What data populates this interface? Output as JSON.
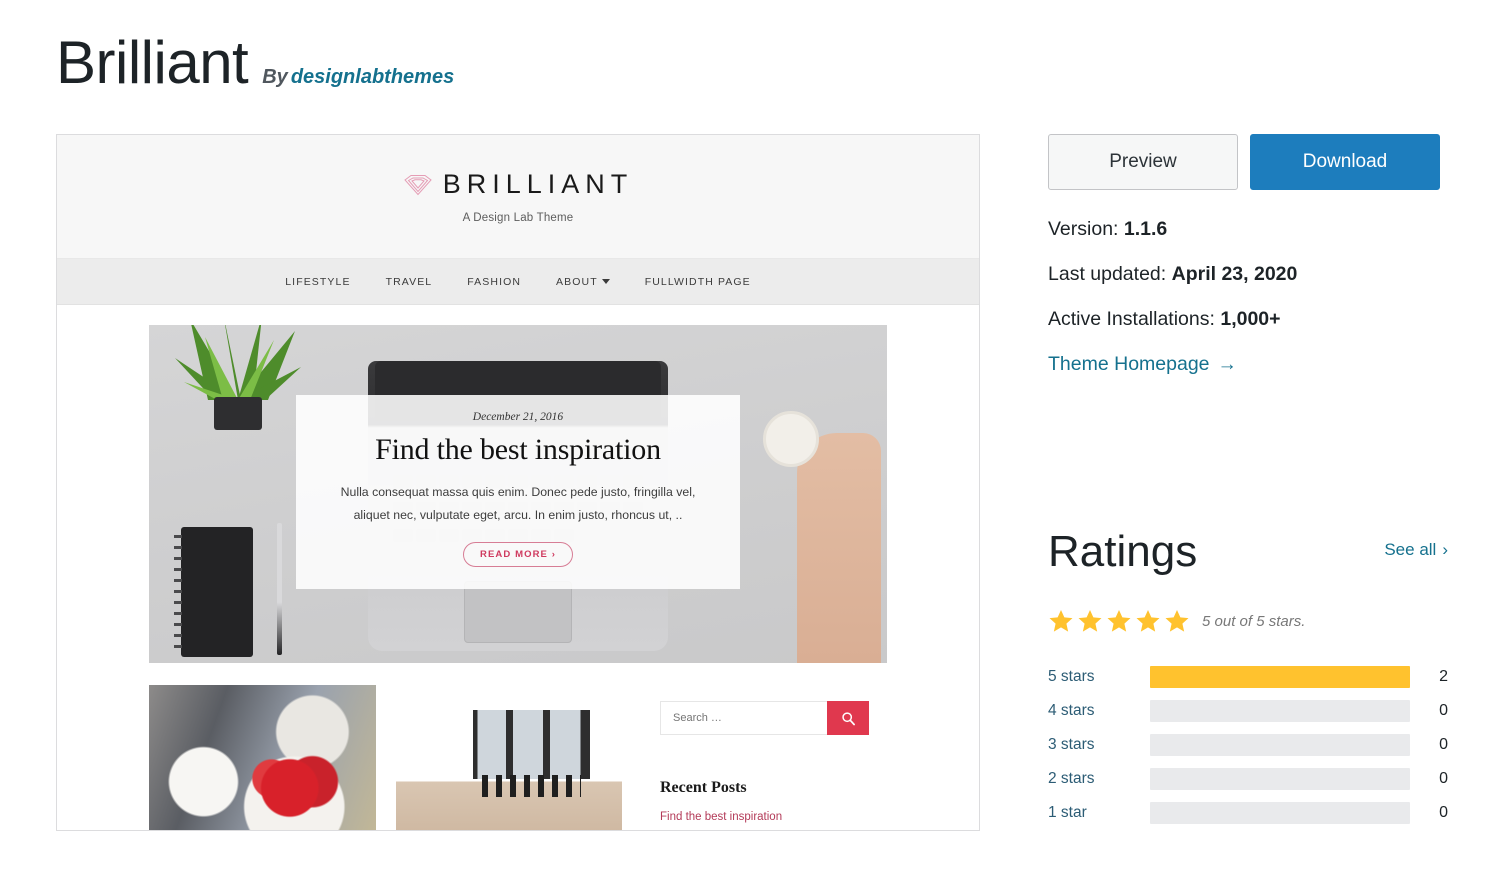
{
  "header": {
    "theme_name": "Brilliant",
    "by_label": "By",
    "author": "designlabthemes"
  },
  "preview": {
    "logo_text": "BRILLIANT",
    "logo_icon": "diamond-icon",
    "tagline": "A Design Lab Theme",
    "nav": [
      {
        "label": "LIFESTYLE",
        "has_dropdown": false
      },
      {
        "label": "TRAVEL",
        "has_dropdown": false
      },
      {
        "label": "FASHION",
        "has_dropdown": false
      },
      {
        "label": "ABOUT",
        "has_dropdown": true
      },
      {
        "label": "FULLWIDTH PAGE",
        "has_dropdown": false
      }
    ],
    "hero": {
      "date": "December 21, 2016",
      "title": "Find the best inspiration",
      "excerpt": "Nulla consequat massa quis enim. Donec pede justo, fringilla vel, aliquet nec, vulputate eget, arcu. In enim justo, rhoncus ut, ..",
      "read_more": "READ MORE ›"
    },
    "search": {
      "placeholder": "Search …",
      "value": "",
      "button_icon": "search-icon"
    },
    "recent_posts": {
      "title": "Recent Posts",
      "items": [
        "Find the best inspiration"
      ]
    }
  },
  "sidebar": {
    "preview_label": "Preview",
    "download_label": "Download",
    "version_label": "Version:",
    "version_value": "1.1.6",
    "updated_label": "Last updated:",
    "updated_value": "April 23, 2020",
    "installs_label": "Active Installations:",
    "installs_value": "1,000+",
    "homepage_label": "Theme Homepage",
    "homepage_arrow": "→"
  },
  "ratings": {
    "title": "Ratings",
    "see_all": "See all",
    "see_all_arrow": "›",
    "star_count": 5,
    "caption": "5 out of 5 stars.",
    "breakdown": [
      {
        "label": "5 stars",
        "count": "2",
        "percent": 100
      },
      {
        "label": "4 stars",
        "count": "0",
        "percent": 0
      },
      {
        "label": "3 stars",
        "count": "0",
        "percent": 0
      },
      {
        "label": "2 stars",
        "count": "0",
        "percent": 0
      },
      {
        "label": "1 star",
        "count": "0",
        "percent": 0
      }
    ]
  },
  "colors": {
    "download_blue": "#1d7dbd",
    "link_teal": "#15718e",
    "star_amber": "#ffc22e",
    "accent_pink": "#cf3a5f",
    "search_red": "#e0384e"
  }
}
